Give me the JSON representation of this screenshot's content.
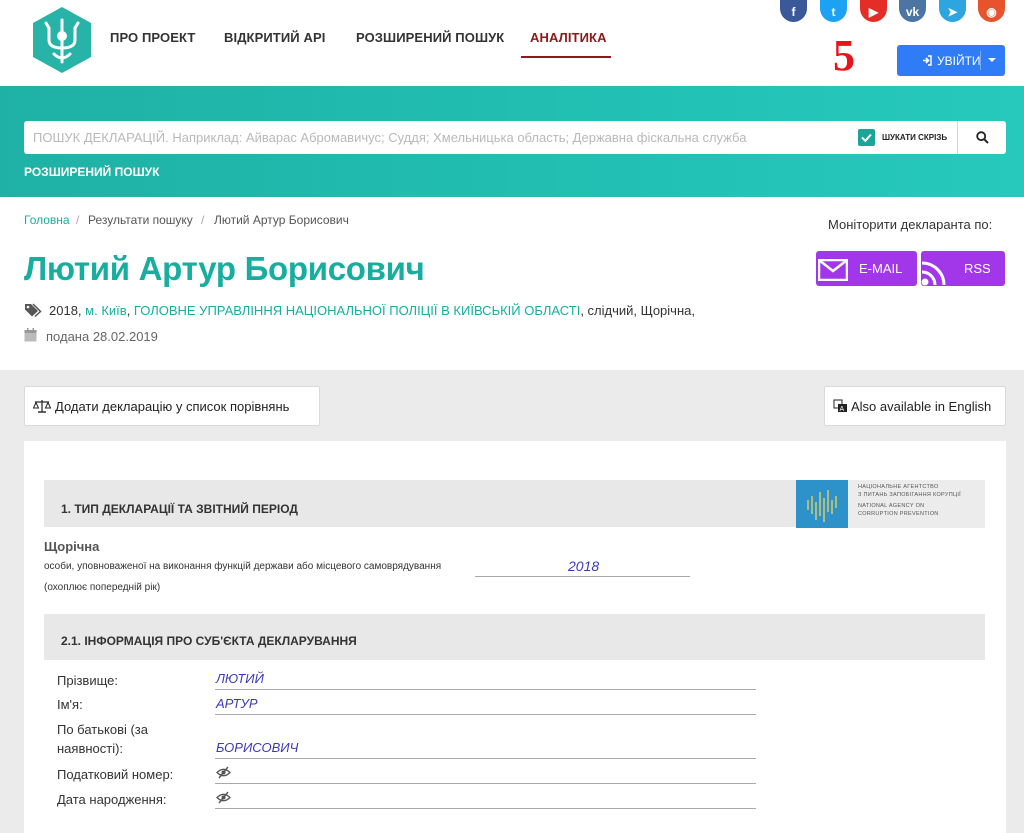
{
  "nav": {
    "items": [
      "ПРО ПРОЕКТ",
      "ВІДКРИТИЙ API",
      "РОЗШИРЕНИЙ ПОШУК",
      "АНАЛІТИКА"
    ],
    "active": "АНАЛІТИКА",
    "login_label": "УВІЙТИ",
    "badge": "5"
  },
  "social": [
    {
      "icon": "facebook-icon",
      "glyph": "f",
      "color": "#3b5998"
    },
    {
      "icon": "twitter-icon",
      "glyph": "t",
      "color": "#1da1f2"
    },
    {
      "icon": "youtube-icon",
      "glyph": "▶",
      "color": "#e52d27"
    },
    {
      "icon": "vk-icon",
      "glyph": "vk",
      "color": "#4c75a3"
    },
    {
      "icon": "telegram-icon",
      "glyph": "➤",
      "color": "#2ca5e0"
    },
    {
      "icon": "rss-icon",
      "glyph": "◉",
      "color": "#e6532d"
    }
  ],
  "search": {
    "placeholder": "ПОШУК ДЕКЛАРАЦІЙ. Наприклад: Айварас Абромавичус; Суддя; Хмельницька область; Державна фіскальна служба",
    "checkbox_label": "ШУКАТИ СКРІЗЬ",
    "advanced_label": "РОЗШИРЕНИЙ ПОШУК"
  },
  "breadcrumb": {
    "home": "Головна",
    "results": "Результати пошуку",
    "current": "Лютий Артур Борисович",
    "sep": "/"
  },
  "monitor": {
    "label": "Моніторити декларанта по:",
    "email": "E-MAIL",
    "rss": "RSS"
  },
  "person": {
    "name": "Лютий Артур Борисович",
    "year": "2018,",
    "city": "м. Київ",
    "org": "ГОЛОВНЕ УПРАВЛІННЯ НАЦІОНАЛЬНОЇ ПОЛІЦІЇ В КИЇВСЬКІЙ ОБЛАСТІ",
    "rest": ", слідчий, Щорічна,",
    "submitted": "подана 28.02.2019"
  },
  "actions": {
    "compare": "Додати декларацію у список порівнянь",
    "english": "Also available in English"
  },
  "nacp": {
    "line1": "НАЦІОНАЛЬНЕ АГЕНТСТВО",
    "line2": "З ПИТАНЬ ЗАПОБІГАННЯ КОРУПЦІЇ",
    "line3": "NATIONAL AGENCY ON",
    "line4": "CORRUPTION PREVENTION"
  },
  "section1": {
    "title": "1.    ТИП ДЕКЛАРАЦІЇ ТА ЗВІТНИЙ ПЕРІОД",
    "type": "Щорічна",
    "desc": "особи, уповноваженої на виконання функцій держави або місцевого самоврядування",
    "year": "2018",
    "note": "(охоплює попередній рік)"
  },
  "section2": {
    "title": "2.1.    ІНФОРМАЦІЯ ПРО СУБ'ЄКТА ДЕКЛАРУВАННЯ",
    "surname_label": "Прізвище:",
    "surname": "ЛЮТИЙ",
    "name_label": "Ім'я:",
    "name": "АРТУР",
    "patronymic_label_1": "По батькові (за",
    "patronymic_label_2": "наявності):",
    "patronymic": "БОРИСОВИЧ",
    "tax_label": "Податковий номер:",
    "birth_label": "Дата народження:"
  }
}
